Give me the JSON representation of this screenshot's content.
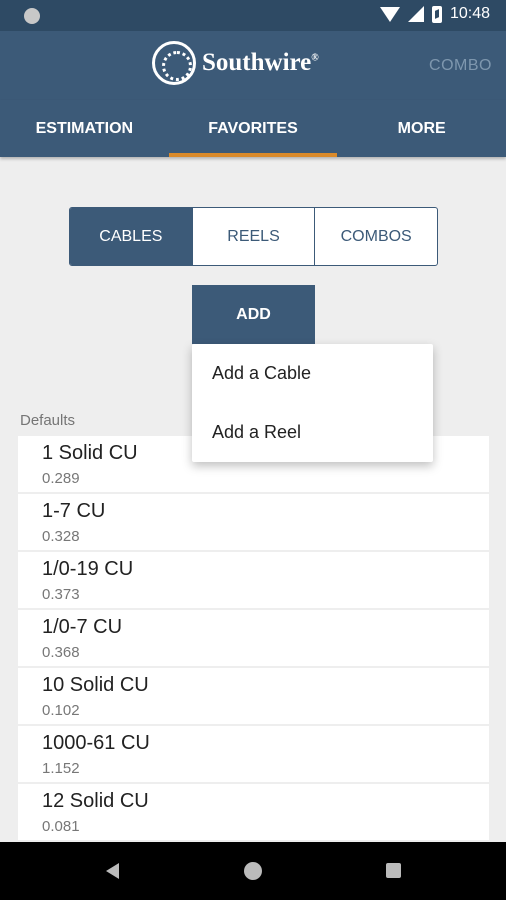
{
  "status_bar": {
    "time": "10:48"
  },
  "app_bar": {
    "logo_text": "Southwire",
    "logo_registered": "®",
    "action": "COMBO"
  },
  "tabs": [
    {
      "label": "ESTIMATION"
    },
    {
      "label": "FAVORITES"
    },
    {
      "label": "MORE"
    }
  ],
  "segment": [
    {
      "label": "CABLES"
    },
    {
      "label": "REELS"
    },
    {
      "label": "COMBOS"
    }
  ],
  "add_button": "ADD",
  "menu": [
    {
      "label": "Add a Cable"
    },
    {
      "label": "Add a Reel"
    }
  ],
  "section_label": "Defaults",
  "items": [
    {
      "name": "1 Solid CU",
      "value": "0.289"
    },
    {
      "name": "1-7 CU",
      "value": "0.328"
    },
    {
      "name": "1/0-19 CU",
      "value": "0.373"
    },
    {
      "name": "1/0-7 CU",
      "value": "0.368"
    },
    {
      "name": "10 Solid CU",
      "value": "0.102"
    },
    {
      "name": "1000-61 CU",
      "value": "1.152"
    },
    {
      "name": "12 Solid CU",
      "value": "0.081"
    }
  ],
  "colors": {
    "primary": "#3c5a78",
    "accent": "#d98a2b",
    "status_bar": "#2e4a64"
  },
  "icons": [
    "status-dot-icon",
    "wifi-icon",
    "signal-icon",
    "battery-icon",
    "southwire-logo-icon",
    "back-icon",
    "home-icon",
    "recents-icon"
  ]
}
